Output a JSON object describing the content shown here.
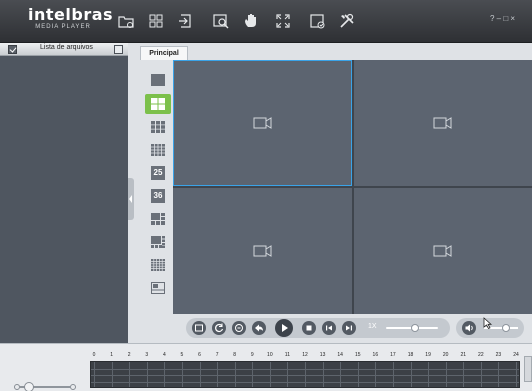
{
  "app": {
    "brand": "intelbras",
    "subtitle": "MEDIA PLAYER",
    "window_controls": "? – □ ×"
  },
  "toolbar": {
    "icons": [
      "open-file-icon",
      "layout-grid-icon",
      "export-icon",
      "search-icon",
      "hand-icon",
      "fullscreen-icon",
      "snapshot-icon",
      "tools-icon"
    ]
  },
  "left_panel": {
    "title": "Lista de arquivos"
  },
  "tabs": [
    {
      "label": "Principal"
    }
  ],
  "layouts": {
    "items": [
      "1",
      "4",
      "9",
      "16",
      "25",
      "36",
      "custom-a",
      "custom-b",
      "custom-c",
      "custom-d"
    ],
    "numeric_labels": [
      "25",
      "36"
    ],
    "active": "4"
  },
  "playback": {
    "speed_label": "1X",
    "speed_level": 0.55,
    "volume_level": 0.65
  },
  "timeline": {
    "hours": [
      "0",
      "1",
      "2",
      "3",
      "4",
      "5",
      "6",
      "7",
      "8",
      "9",
      "10",
      "11",
      "12",
      "13",
      "14",
      "15",
      "16",
      "17",
      "18",
      "19",
      "20",
      "21",
      "22",
      "23",
      "24"
    ]
  },
  "colors": {
    "accent": "#7cc04b",
    "selection": "#3aa3e8",
    "video_cell": "#5c6470",
    "toolbar": "#3a3d42"
  }
}
